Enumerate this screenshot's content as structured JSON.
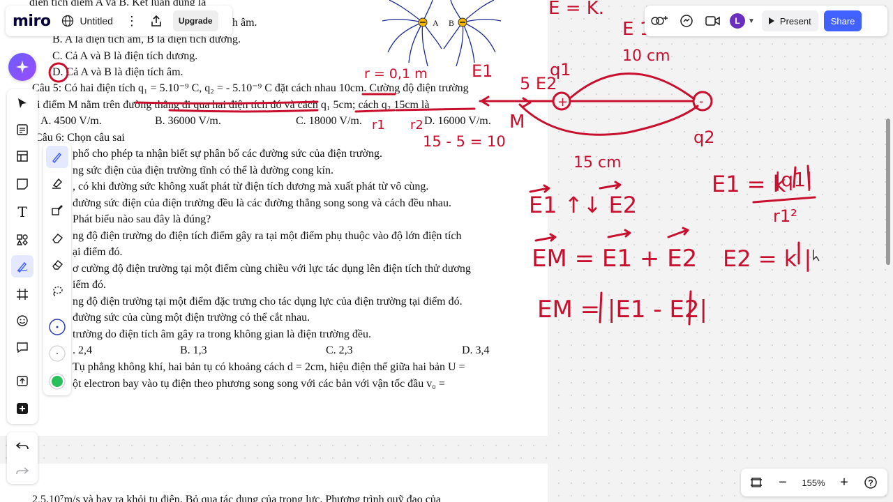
{
  "app": {
    "logo": "miro",
    "board_title": "Untitled",
    "upgrade_label": "Upgrade",
    "present_label": "Present",
    "share_label": "Share",
    "avatar_initial": "L",
    "zoom_level": "155%",
    "accent_color": "#4262ff"
  },
  "document": {
    "lines": [
      "điện tích điểm A và B. Kết luận đúng là",
      "h âm.",
      "B. A là điện tích âm, B là điện tích dương.",
      "C. Cả A và B là điện tích dương.",
      "D. Cả A và B là điện tích âm.",
      "Câu 5: Có hai điện tích q₁ = 5.10⁻⁹ C, q₂ = - 5.10⁻⁹ C  đặt cách nhau 10cm. Cường độ điện trường",
      "ại điểm M nằm trên đường thẳng đi qua hai điện tích đó và cách q₁ 5cm; cách q₂ 15cm là",
      "A. 4500 V/m.",
      "B. 36000 V/m.",
      "C. 18000 V/m.",
      "D. 16000 V/m.",
      "Câu 6: Chọn câu sai",
      "phổ cho phép ta nhận biết sự phân bố các đường sức của điện trường.",
      "ng sức điện của điện trường tĩnh có thể là đường cong kín.",
      ", có khi đường sức không xuất phát từ điện tích dương mà xuất phát từ vô cùng.",
      "đường sức điện của điện trường đều là các đường thẳng song song và cách đều nhau.",
      "Phát biểu nào sau đây là đúng?",
      "ng độ điện trường do điện tích điểm gây ra tại một điểm phụ thuộc vào độ lớn điện tích",
      "ại điểm đó.",
      "ơ cường độ điện trường tại một điểm cùng chiều với lực tác dụng lên điện tích thử dương",
      "iểm đó.",
      "ng độ điện trường tại một điểm đặc trưng cho tác dụng lực của điện trường tại điểm đó.",
      "đường sức của cùng một điện trường có thể cắt nhau.",
      "trường do điện tích âm gây ra trong không gian là điện trường đều.",
      ". 2,4",
      "B. 1,3",
      "C. 2,3",
      "D. 3,4",
      "Tụ phẳng không khí, hai bản tụ có khoảng cách d = 2cm, hiệu điện thế giữa hai bản U =",
      "ột electron bay vào tụ điện theo phương song song với các bản với vận tốc đầu v₀ =",
      "2,5.10⁷m/s và bay ra khỏi tụ điện. Bỏ qua tác dụng của trọng lực. Phương trình quỹ đạo của"
    ],
    "figure_labels": [
      "A",
      "B"
    ]
  },
  "handwriting": {
    "r": "r = 0,1 m",
    "dist_top": "10 cm",
    "dist_bottom": "15 cm",
    "q1": "q1",
    "q2": "q2",
    "M": "M",
    "plus": "+",
    "minus": "-",
    "r1": "r1",
    "r2": "r2",
    "calc": "15 - 5 = 10",
    "e1_label": "E1",
    "e2_label": "5 E2",
    "vec_rel": "E1 ↑↓ E2",
    "em_sum": "EM = E1 + E2",
    "em_abs": "EM = |E1 - E2|",
    "e1_formula_lhs": "E1 = k",
    "e1_formula_num": "|q1|",
    "e1_formula_den": "r1²",
    "e2_formula": "E2 = k |",
    "top_partial_1": "E = K.",
    "top_partial_2": "E 1",
    "ink_color": "#c8102e"
  },
  "icons": {
    "toolbar": [
      "cursor-icon",
      "sticky-template-icon",
      "table-icon",
      "sticky-note-icon",
      "text-icon",
      "shapes-icon",
      "pen-icon",
      "frame-icon",
      "emoji-icon",
      "comment-icon",
      "upload-icon",
      "plus-icon"
    ],
    "pen_panel": [
      "pen-icon",
      "highlighter-icon",
      "pen-shape-icon",
      "eraser-icon",
      "object-eraser-icon",
      "lasso-icon",
      "color-blue-icon",
      "color-white-icon",
      "color-green-icon"
    ]
  }
}
